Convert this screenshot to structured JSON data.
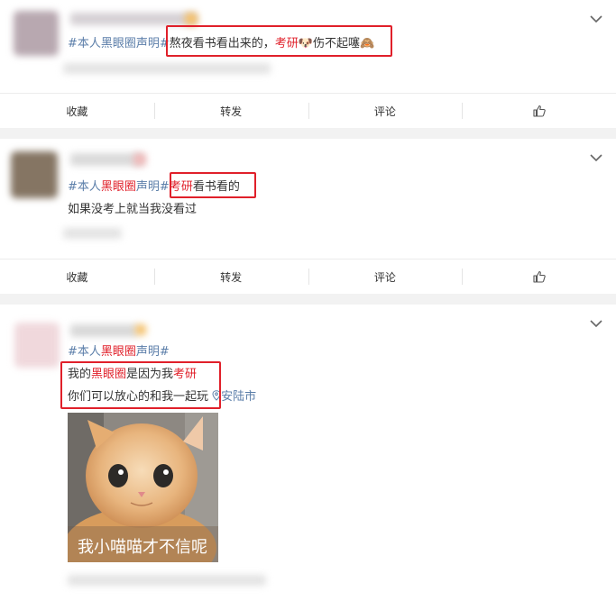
{
  "posts": [
    {
      "text": {
        "topic": "#本人黑眼圈声明#",
        "highlight": "熬夜看书看出来的，",
        "red": "考研",
        "emoji": "🐶",
        "tail": "伤不起噻🙈"
      },
      "actions": {
        "collect": "收藏",
        "forward": "转发",
        "comment": "评论"
      }
    },
    {
      "text": {
        "topic_a": "#本人",
        "topic_b": "黑眼圈",
        "topic_c": "声明#",
        "red": "考研",
        "highlight": "看书看的",
        "line2": "如果没考上就当我没看过"
      },
      "actions": {
        "collect": "收藏",
        "forward": "转发",
        "comment": "评论"
      }
    },
    {
      "text": {
        "topic_a": "#本人",
        "topic_b": "黑眼圈",
        "topic_c": "声明#",
        "line1_a": "我的",
        "line1_b": "黑眼圈",
        "line1_c": "是因为我",
        "line1_d": "考研",
        "line2": "你们可以放心的和我一起玩",
        "location": "安陆市",
        "image_caption": "我小喵喵才不信呢"
      }
    }
  ],
  "colors": {
    "accent_red": "#e0202a",
    "topic_blue": "#5b7ea9",
    "topic_orange": "#eb7350"
  }
}
